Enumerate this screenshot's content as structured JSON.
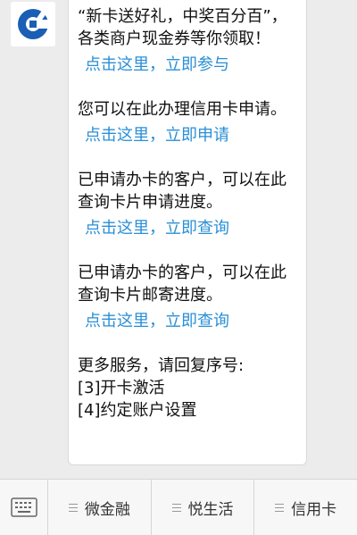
{
  "message": {
    "promo_text": "“新卡送好礼，中奖百分百”，各类商户现金券等你领取！",
    "promo_link": "点击这里，立即参与",
    "apply_text": "您可以在此办理信用卡申请。",
    "apply_link": "点击这里，立即申请",
    "progress_text": "已申请办卡的客户，可以在此查询卡片申请进度。",
    "progress_link": "点击这里，立即查询",
    "mail_text": "已申请办卡的客户，可以在此查询卡片邮寄进度。",
    "mail_link": "点击这里，立即查询",
    "more_title": "更多服务，请回复序号:",
    "option_1": "[3]开卡激活",
    "option_2": "[4]约定账户设置"
  },
  "bottom_bar": {
    "keyboard_icon": "keyboard-icon",
    "tabs": [
      {
        "label": "微金融"
      },
      {
        "label": "悦生活"
      },
      {
        "label": "信用卡"
      }
    ]
  },
  "colors": {
    "brand_blue": "#1a5fb4",
    "link_blue": "#2a8fd6"
  }
}
